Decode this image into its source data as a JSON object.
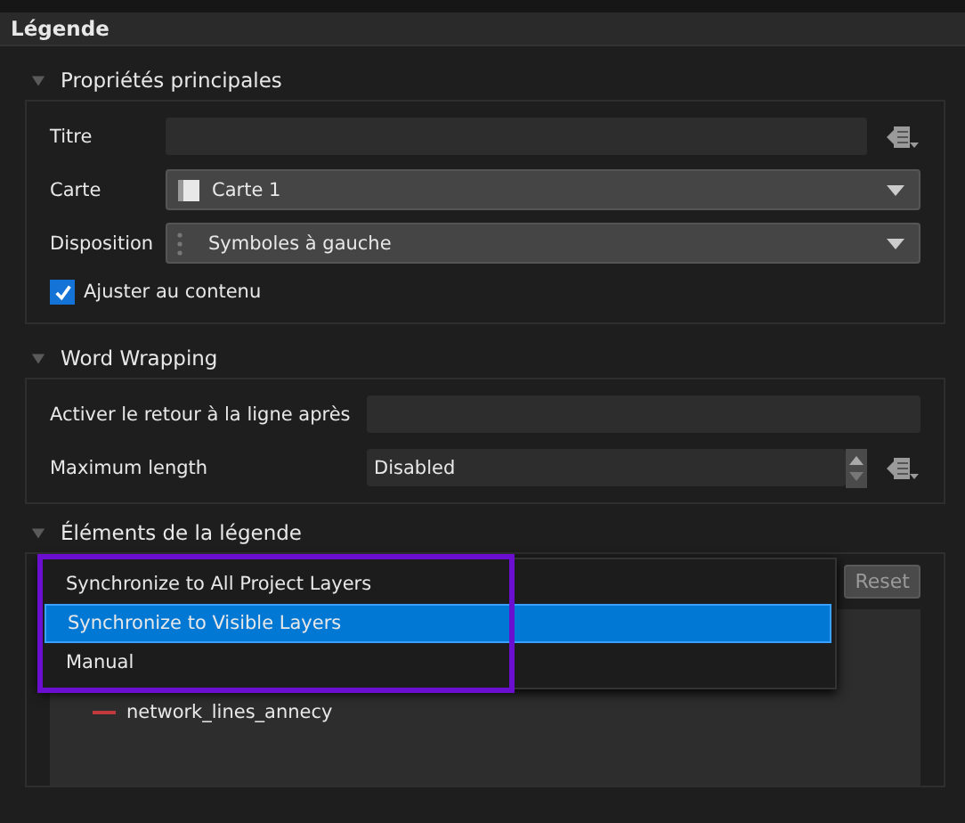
{
  "panel": {
    "title": "Légende"
  },
  "main": {
    "title": "Propriétés principales",
    "expanded": true,
    "rows": [
      {
        "kind": "text",
        "label": "Titre"
      },
      {
        "kind": "map",
        "label": "Carte",
        "value": "Carte 1"
      },
      {
        "kind": "layout",
        "label": "Disposition",
        "value": "Symboles à gauche"
      },
      {
        "kind": "checkbox",
        "label": "Ajuster au contenu",
        "checked": true
      }
    ]
  },
  "wrapping": {
    "title": "Word Wrapping",
    "expanded": true,
    "rows": [
      {
        "kind": "text",
        "label": "Activer le retour à la ligne après"
      },
      {
        "kind": "spin",
        "label": "Maximum length",
        "value": "Disabled"
      }
    ]
  },
  "items": {
    "title": "Éléments de la légende",
    "expanded": true,
    "reset": "Reset",
    "layers": [
      {
        "name": "network_lines_annecy",
        "color": "#c0393b"
      }
    ]
  },
  "sync_menu": {
    "options": [
      {
        "label": "Synchronize to All Project Layers",
        "selected": false
      },
      {
        "label": "Synchronize to Visible Layers",
        "selected": true
      },
      {
        "label": "Manual",
        "selected": false
      }
    ]
  }
}
